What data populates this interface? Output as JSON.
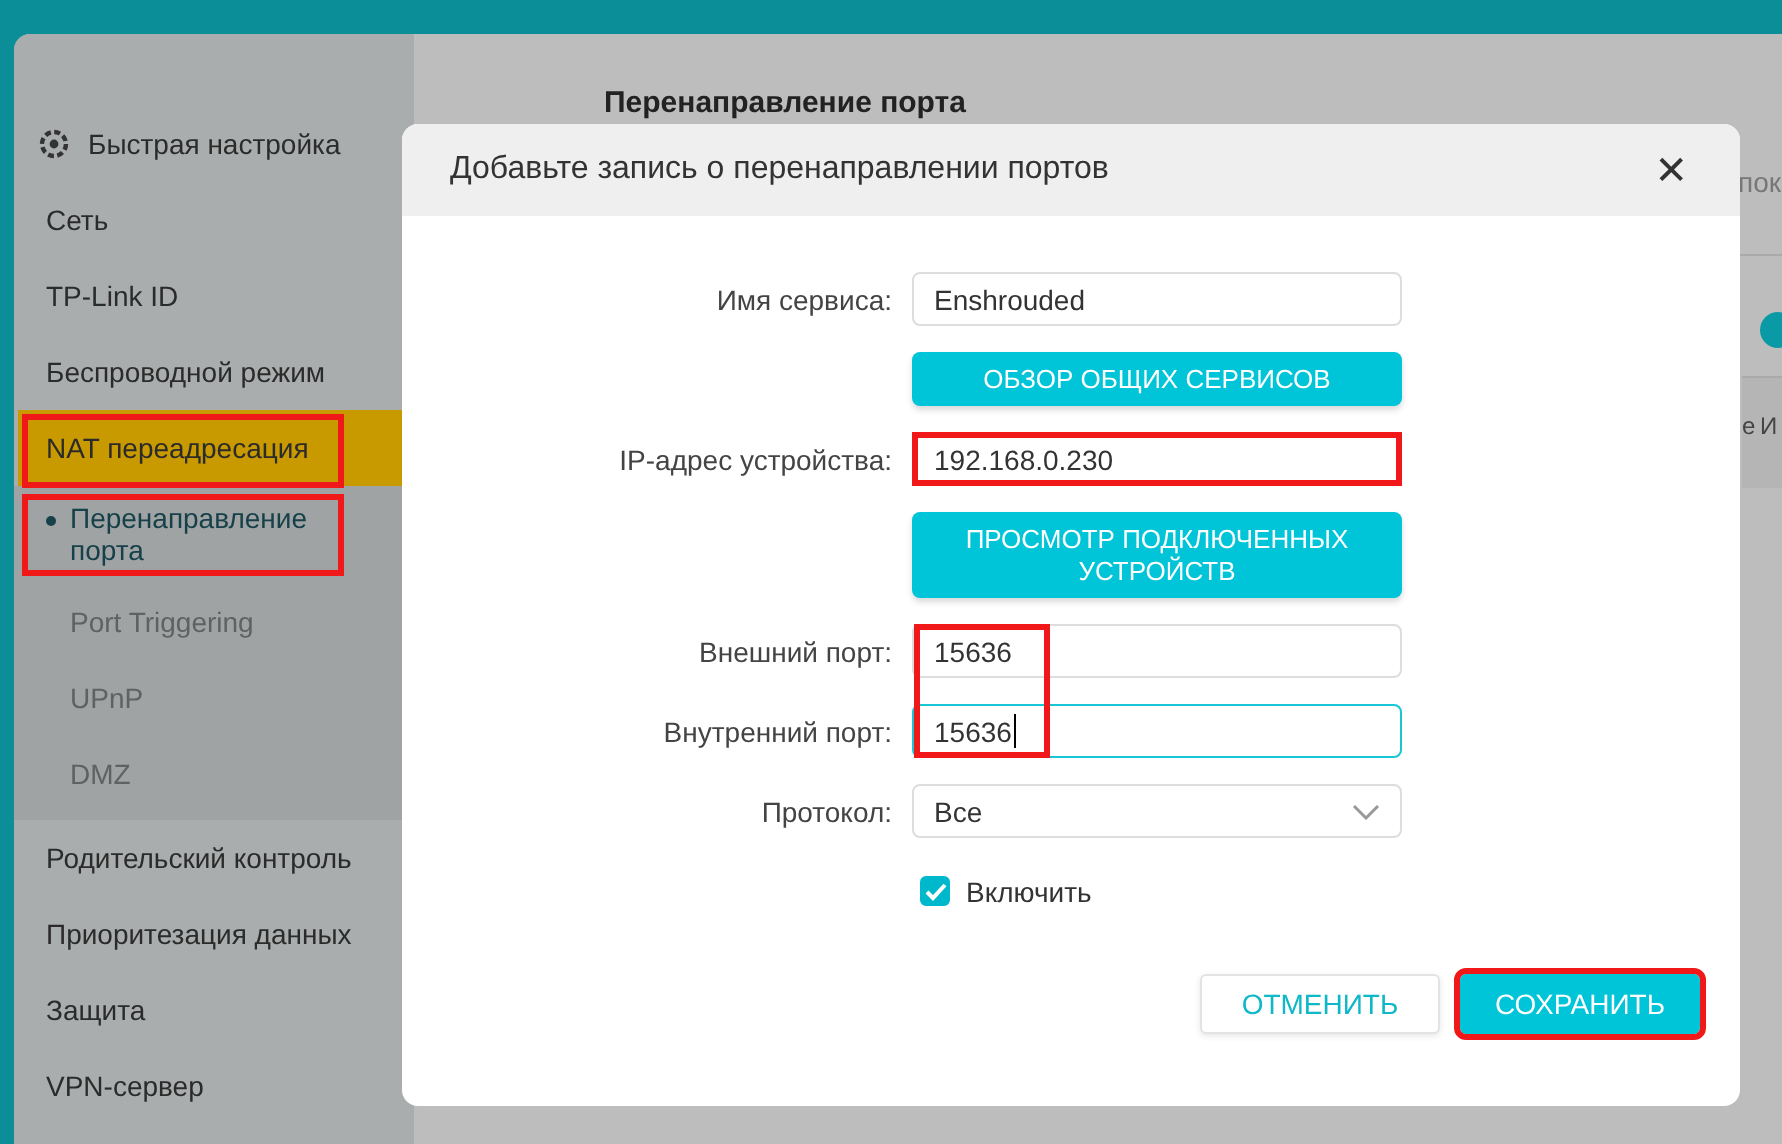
{
  "sidebar": {
    "items": [
      {
        "label": "Быстрая настройка",
        "kind": "gear",
        "selected": false,
        "highlighted": false
      },
      {
        "label": "Сеть",
        "kind": "plain",
        "selected": false,
        "highlighted": false
      },
      {
        "label": "TP-Link ID",
        "kind": "plain",
        "selected": false,
        "highlighted": false
      },
      {
        "label": "Беспроводной режим",
        "kind": "plain",
        "selected": false,
        "highlighted": false
      },
      {
        "label": "NAT переадресация",
        "kind": "plain",
        "selected": true,
        "highlighted": true,
        "children": [
          {
            "label": "Перенаправление порта",
            "selected": true,
            "highlighted": true
          },
          {
            "label": "Port Triggering",
            "selected": false,
            "highlighted": false
          },
          {
            "label": "UPnP",
            "selected": false,
            "highlighted": false
          },
          {
            "label": "DMZ",
            "selected": false,
            "highlighted": false
          }
        ]
      },
      {
        "label": "Родительский контроль",
        "kind": "plain",
        "selected": false,
        "highlighted": false
      },
      {
        "label": "Приоритезация данных",
        "kind": "plain",
        "selected": false,
        "highlighted": false
      },
      {
        "label": "Защита",
        "kind": "plain",
        "selected": false,
        "highlighted": false
      },
      {
        "label": "VPN-сервер",
        "kind": "plain",
        "selected": false,
        "highlighted": false
      }
    ]
  },
  "page": {
    "title": "Перенаправление порта",
    "fragment_top": "пок",
    "fragment_header": "е И"
  },
  "dialog": {
    "title": "Добавьте запись о перенаправлении портов",
    "close": "✕",
    "rows": [
      {
        "kind": "field",
        "label": "Имя сервиса:",
        "value": "Enshrouded",
        "focused": false,
        "highlighted": false
      },
      {
        "kind": "button",
        "label": "ОБЗОР ОБЩИХ СЕРВИСОВ"
      },
      {
        "kind": "field",
        "label": "IP-адрес устройства:",
        "value": "192.168.0.230",
        "focused": false,
        "highlighted": true
      },
      {
        "kind": "button",
        "label": "ПРОСМОТР ПОДКЛЮЧЕННЫХ УСТРОЙСТВ"
      },
      {
        "kind": "field",
        "label": "Внешний порт:",
        "value": "15636",
        "focused": false,
        "highlighted": false
      },
      {
        "kind": "field",
        "label": "Внутренний порт:",
        "value": "15636",
        "focused": true,
        "highlighted": false
      },
      {
        "kind": "select",
        "label": "Протокол:",
        "value": "Все"
      },
      {
        "kind": "checkbox",
        "label": "Включить",
        "checked": true
      }
    ],
    "ports_highlighted": true,
    "buttons": [
      {
        "label": "ОТМЕНИТЬ",
        "kind": "secondary",
        "highlighted": false
      },
      {
        "label": "СОХРАНИТЬ",
        "kind": "primary",
        "highlighted": true
      }
    ]
  }
}
